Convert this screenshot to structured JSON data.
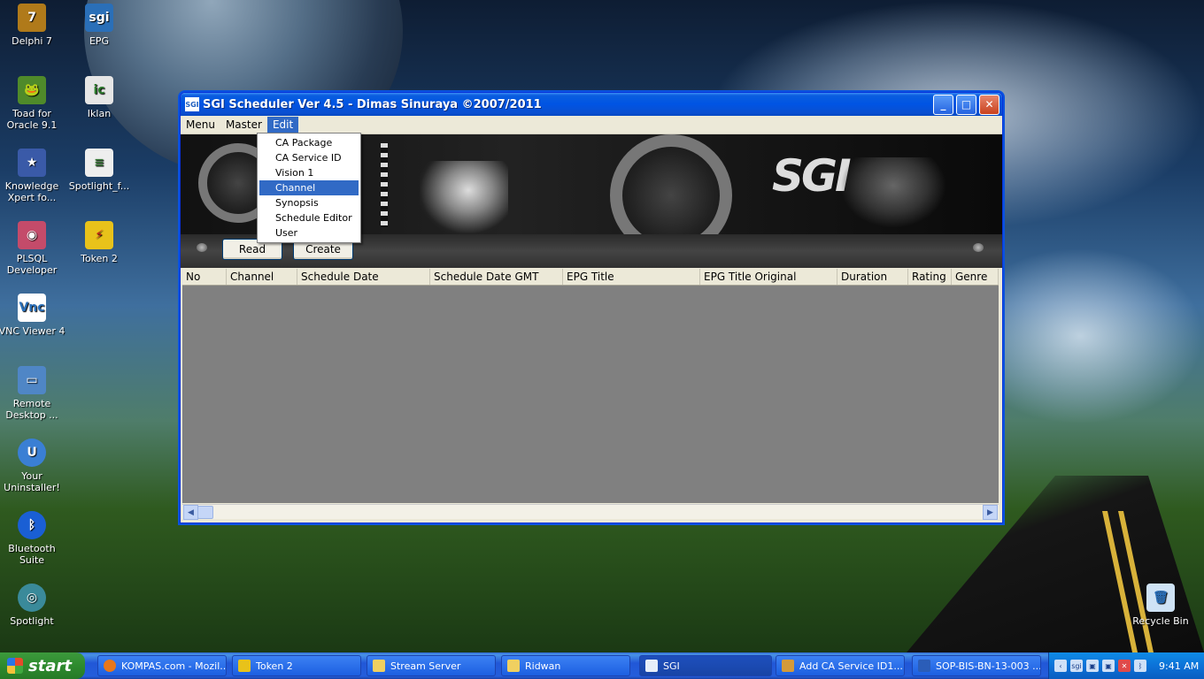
{
  "desktop": {
    "icons": [
      {
        "label": "Delphi 7"
      },
      {
        "label": "EPG"
      },
      {
        "label": "Toad for Oracle 9.1"
      },
      {
        "label": "Iklan"
      },
      {
        "label": "Knowledge Xpert fo..."
      },
      {
        "label": "Spotlight_f..."
      },
      {
        "label": "PLSQL Developer"
      },
      {
        "label": "Token 2"
      },
      {
        "label": "VNC Viewer 4"
      },
      {
        "label": "Remote Desktop ..."
      },
      {
        "label": "Your Uninstaller!"
      },
      {
        "label": "Bluetooth Suite"
      },
      {
        "label": "Spotlight"
      },
      {
        "label": "Recycle Bin"
      }
    ]
  },
  "window": {
    "title": "SGI Scheduler Ver 4.5 - Dimas Sinuraya ©2007/2011",
    "app_icon_text": "SGI",
    "menu": [
      "Menu",
      "Master",
      "Edit"
    ],
    "banner_logo": "SGI",
    "toolbar": {
      "read": "Read",
      "create": "Create"
    },
    "columns": [
      "No",
      "Channel",
      "Schedule Date",
      "Schedule Date GMT",
      "EPG Title",
      "EPG Title Original",
      "Duration",
      "Rating",
      "Genre"
    ],
    "edit_menu": {
      "items": [
        "CA Package",
        "CA Service ID",
        "Vision 1",
        "Channel",
        "Synopsis",
        "Schedule Editor",
        "User"
      ],
      "selected": "Channel"
    }
  },
  "taskbar": {
    "start": "start",
    "tasks": [
      {
        "label": "KOMPAS.com - Mozil..."
      },
      {
        "label": "Token 2"
      },
      {
        "label": "Stream Server"
      },
      {
        "label": "Ridwan"
      },
      {
        "label": "SGI"
      },
      {
        "label": "Add CA Service ID1...."
      },
      {
        "label": "SOP-BIS-BN-13-003 ..."
      }
    ],
    "clock": "9:41 AM"
  },
  "colors": {
    "titlebar": "#0054e3",
    "selection": "#316ac5",
    "grid_bg": "#808080",
    "taskbar": "#245edb",
    "start": "#2e8a2e"
  }
}
